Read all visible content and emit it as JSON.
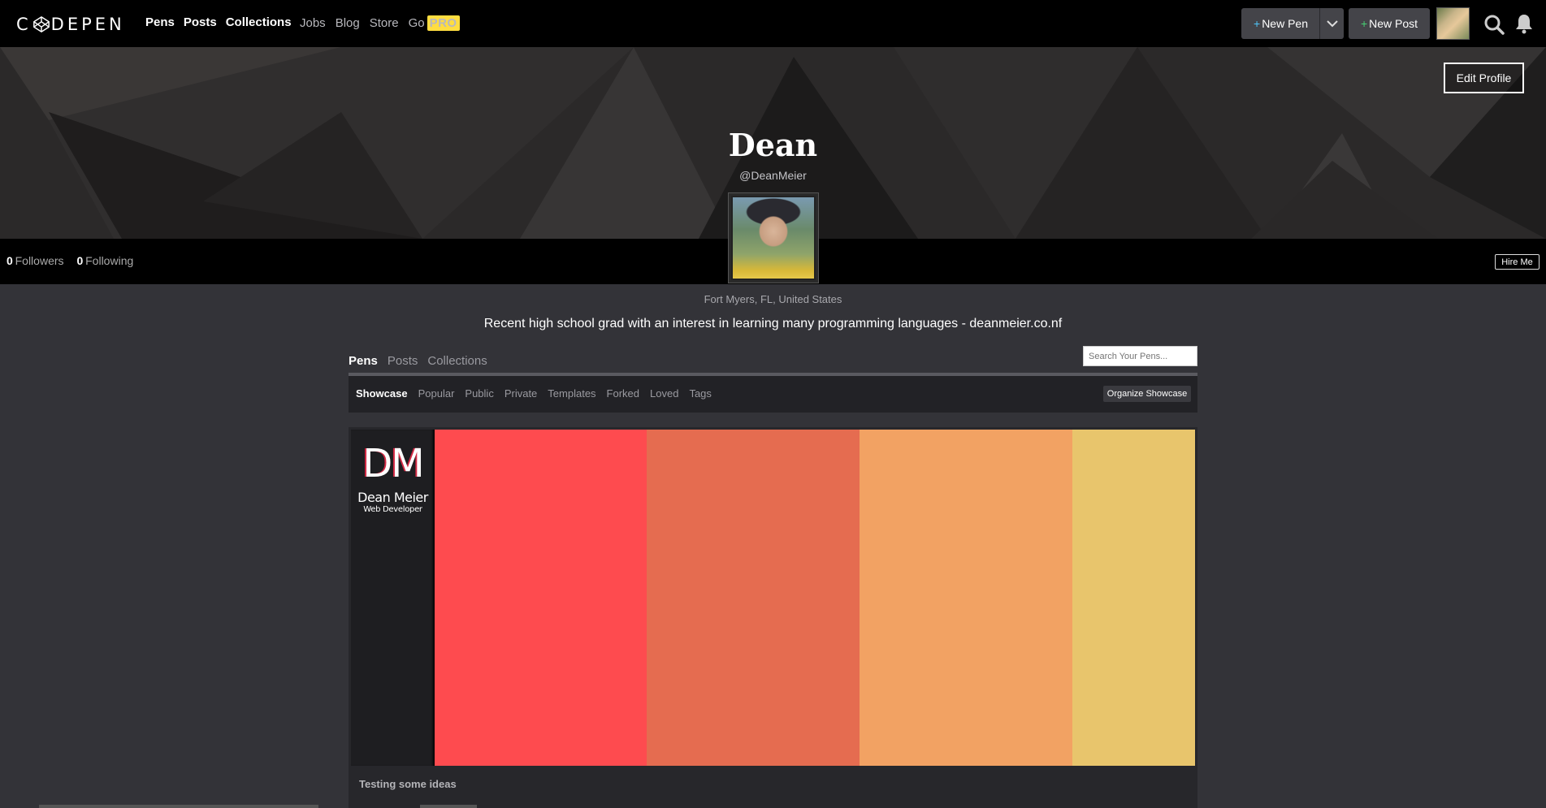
{
  "nav": {
    "logo": "CODEPEN",
    "main_links": [
      "Pens",
      "Posts",
      "Collections"
    ],
    "sub_links": [
      "Jobs",
      "Blog",
      "Store"
    ],
    "go_label": "Go",
    "pro_badge": "PRO",
    "new_pen_label": "New Pen",
    "new_post_label": "New Post",
    "icons": [
      "chevron-down-icon",
      "search-icon",
      "bell-icon"
    ]
  },
  "profile": {
    "edit_label": "Edit Profile",
    "name": "Dean",
    "handle": "@DeanMeier",
    "followers_count": "0",
    "followers_label": "Followers",
    "following_count": "0",
    "following_label": "Following",
    "hire_label": "Hire Me",
    "location": "Fort Myers, FL, United States",
    "bio": "Recent high school grad with an interest in learning many programming languages - deanmeier.co.nf"
  },
  "tabs": {
    "items": [
      "Pens",
      "Posts",
      "Collections"
    ],
    "active": "Pens",
    "search_placeholder": "Search Your Pens..."
  },
  "subtabs": {
    "items": [
      "Showcase",
      "Popular",
      "Public",
      "Private",
      "Templates",
      "Forked",
      "Loved",
      "Tags"
    ],
    "active": "Showcase",
    "organize_label": "Organize Showcase"
  },
  "pen": {
    "logo_letters": "DM",
    "logo_name": "Dean Meier",
    "logo_sub": "Web Developer",
    "title": "Testing some ideas",
    "swatches": [
      "#fe4b4f",
      "#e56c50",
      "#f2a263",
      "#e8c56c"
    ]
  },
  "colors": {
    "accent_blue": "#4fc3f7",
    "accent_green": "#47cf73",
    "pro_yellow": "#ffdd40"
  }
}
